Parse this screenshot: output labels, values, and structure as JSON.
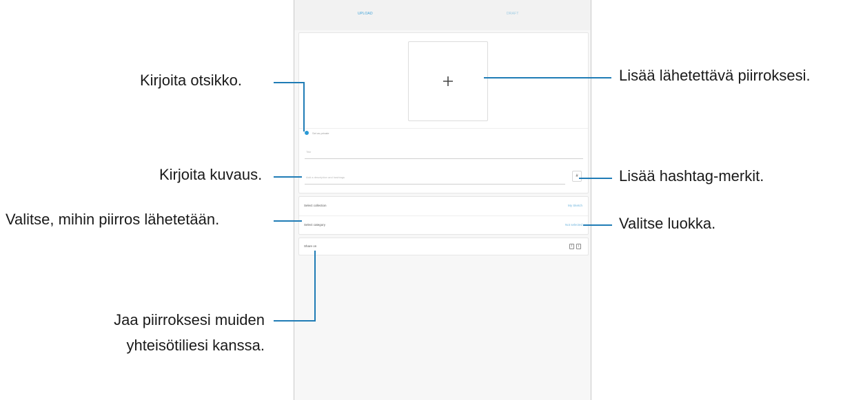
{
  "tabs": {
    "active": "UPLOAD",
    "other": "DRAFT"
  },
  "upload": {
    "plus_label": "+"
  },
  "options": {
    "radio_label": "Set as private"
  },
  "fields": {
    "title_placeholder": "Title",
    "description_placeholder": "Add a description and hashtags",
    "hashtag_label": "#"
  },
  "select": {
    "collection_label": "Select collection",
    "collection_value": "My Sketch",
    "category_label": "Select category",
    "category_value": "Not selected"
  },
  "share": {
    "label": "Share on",
    "icons": [
      "facebook-icon",
      "twitter-icon"
    ]
  },
  "annotations": {
    "title": "Kirjoita otsikko.",
    "description": "Kirjoita kuvaus.",
    "collection": "Valitse, mihin piirros lähetetään.",
    "share_line1": "Jaa piirroksesi muiden",
    "share_line2": "yhteisötiliesi kanssa.",
    "add_drawing": "Lisää lähetettävä piirroksesi.",
    "hashtags": "Lisää hashtag-merkit.",
    "category": "Valitse luokka."
  },
  "colors": {
    "leader": "#1e7bb5",
    "accent": "#2b9ad6"
  }
}
